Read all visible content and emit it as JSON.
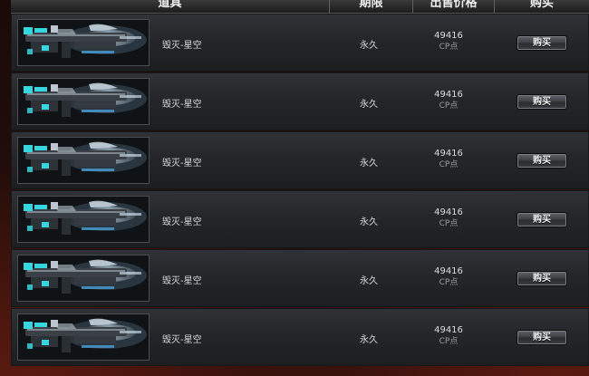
{
  "header": {
    "col_item": "道具",
    "col_limit": "期限",
    "col_price": "出售价格",
    "col_buy": "购买"
  },
  "items": [
    {
      "name": "毁灭-星空",
      "limit": "永久",
      "price": "49416",
      "unit": "CP点",
      "buy_label": "购买",
      "icon": "weapon-thumbnail"
    },
    {
      "name": "毁灭-星空",
      "limit": "永久",
      "price": "49416",
      "unit": "CP点",
      "buy_label": "购买",
      "icon": "weapon-thumbnail"
    },
    {
      "name": "毁灭-星空",
      "limit": "永久",
      "price": "49416",
      "unit": "CP点",
      "buy_label": "购买",
      "icon": "weapon-thumbnail"
    },
    {
      "name": "毁灭-星空",
      "limit": "永久",
      "price": "49416",
      "unit": "CP点",
      "buy_label": "购买",
      "icon": "weapon-thumbnail"
    },
    {
      "name": "毁灭-星空",
      "limit": "永久",
      "price": "49416",
      "unit": "CP点",
      "buy_label": "购买",
      "icon": "weapon-thumbnail"
    },
    {
      "name": "毁灭-星空",
      "limit": "永久",
      "price": "49416",
      "unit": "CP点",
      "buy_label": "购买",
      "icon": "weapon-thumbnail"
    }
  ],
  "colors": {
    "accent_cyan": "#34d6e0",
    "row_bg": "#26292c",
    "text": "#d8d8d8"
  }
}
